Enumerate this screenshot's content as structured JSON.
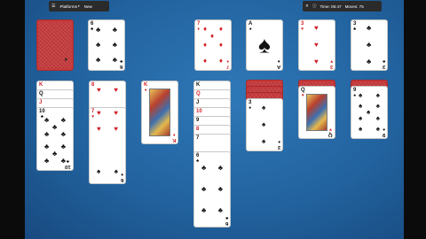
{
  "toolbar": {
    "menu_icon": "☰",
    "platforms_label": "Platforms",
    "new_label": "New",
    "close_icon": "✕",
    "info_icon": "ⓘ",
    "time_text": "Time: 06:47",
    "moves_text": "Moves: 75"
  },
  "suits": {
    "clubs": "♣",
    "spades": "♠",
    "hearts": "♥",
    "diamonds": "♦"
  },
  "waste_card": {
    "rank": "6",
    "suit": "♣"
  },
  "foundations": [
    {
      "rank": "7",
      "suit": "♦"
    },
    {
      "rank": "A",
      "suit": "♠"
    },
    {
      "rank": "3",
      "suit": "♥"
    },
    {
      "rank": "3",
      "suit": "♣"
    }
  ],
  "tableau": [
    {
      "peek": [
        "K",
        "Q",
        "J"
      ],
      "top": {
        "rank": "10",
        "suit": "♣"
      }
    },
    {
      "peek": [
        "8",
        "7"
      ],
      "top": {
        "rank": "6",
        "suit": "♠"
      }
    },
    {
      "peek": [],
      "top": {
        "rank": "K",
        "suit": "♦"
      }
    },
    {
      "peek": [
        "K",
        "Q",
        "J",
        "10",
        "9",
        "8",
        "7"
      ],
      "top": {
        "rank": "6",
        "suit": "♣"
      }
    },
    {
      "peek": [],
      "top": {
        "rank": "3",
        "suit": "♠"
      }
    },
    {
      "peek": [],
      "top": {
        "rank": "Q",
        "suit": "♥"
      }
    },
    {
      "peek": [],
      "top": {
        "rank": "9",
        "suit": "♠"
      }
    }
  ]
}
